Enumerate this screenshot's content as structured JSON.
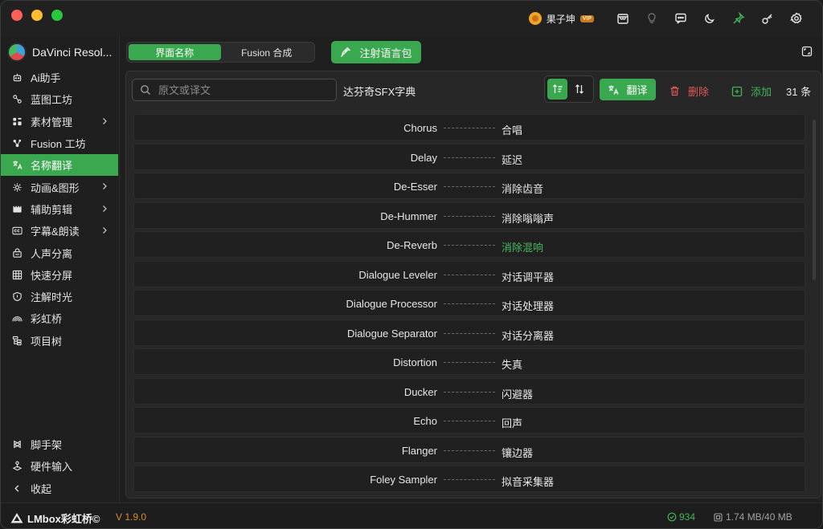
{
  "window": {
    "traffic_lights": [
      "close",
      "minimize",
      "zoom"
    ]
  },
  "titlebar": {
    "user_name": "果子坤",
    "vip_badge": "VIP",
    "icons": [
      "store-icon",
      "lightbulb-icon",
      "message-icon",
      "moon-icon",
      "pin-icon",
      "key-icon",
      "settings-icon"
    ]
  },
  "sidebar": {
    "app_title": "DaVinci Resol...",
    "items": [
      {
        "label": "Ai助手",
        "icon": "robot-icon",
        "has_submenu": false
      },
      {
        "label": "蓝图工坊",
        "icon": "blueprint-icon",
        "has_submenu": false
      },
      {
        "label": "素材管理",
        "icon": "assets-icon",
        "has_submenu": true
      },
      {
        "label": "Fusion 工坊",
        "icon": "fusion-icon",
        "has_submenu": false
      },
      {
        "label": "名称翻译",
        "icon": "translate-icon",
        "has_submenu": false,
        "active": true
      },
      {
        "label": "动画&图形",
        "icon": "animation-icon",
        "has_submenu": true
      },
      {
        "label": "辅助剪辑",
        "icon": "edit-icon",
        "has_submenu": true
      },
      {
        "label": "字幕&朗读",
        "icon": "cc-icon",
        "has_submenu": true
      },
      {
        "label": "人声分离",
        "icon": "voice-icon",
        "has_submenu": false
      },
      {
        "label": "快速分屏",
        "icon": "grid-icon",
        "has_submenu": false
      },
      {
        "label": "注解时光",
        "icon": "shield-icon",
        "has_submenu": false
      },
      {
        "label": "彩虹桥",
        "icon": "rainbow-icon",
        "has_submenu": false
      },
      {
        "label": "项目树",
        "icon": "tree-icon",
        "has_submenu": false
      }
    ],
    "bottom_items": [
      {
        "label": "脚手架",
        "icon": "scaffold-icon"
      },
      {
        "label": "硬件输入",
        "icon": "joystick-icon"
      },
      {
        "label": "收起",
        "icon": "collapse-icon"
      }
    ]
  },
  "toolbar": {
    "tabs": [
      {
        "label": "界面名称",
        "active": true
      },
      {
        "label": "Fusion 合成",
        "active": false
      }
    ],
    "inject_label": "注射语言包"
  },
  "panel": {
    "search_placeholder": "原文或译文",
    "dictionary_name": "达芬奇SFX字典",
    "translate_label": "翻译",
    "delete_label": "删除",
    "add_label": "添加",
    "count_label": "31 条"
  },
  "entries": [
    {
      "en": "Chorus",
      "zh": "合唱"
    },
    {
      "en": "Delay",
      "zh": "延迟"
    },
    {
      "en": "De-Esser",
      "zh": "消除齿音"
    },
    {
      "en": "De-Hummer",
      "zh": "消除嗡嗡声"
    },
    {
      "en": "De-Reverb",
      "zh": "消除混响",
      "highlighted": true
    },
    {
      "en": "Dialogue Leveler",
      "zh": "对话调平器"
    },
    {
      "en": "Dialogue Processor",
      "zh": "对话处理器"
    },
    {
      "en": "Dialogue Separator",
      "zh": "对话分离器"
    },
    {
      "en": "Distortion",
      "zh": "失真"
    },
    {
      "en": "Ducker",
      "zh": "闪避器"
    },
    {
      "en": "Echo",
      "zh": "回声"
    },
    {
      "en": "Flanger",
      "zh": "镶边器"
    },
    {
      "en": "Foley Sampler",
      "zh": "拟音采集器"
    }
  ],
  "statusbar": {
    "brand": "LMbox彩虹桥©",
    "version": "V 1.9.0",
    "stat_count": "934",
    "memory": "1.74 MB/40 MB"
  },
  "colors": {
    "accent": "#3aa84f",
    "danger": "#e05a5a",
    "version": "#d98a2a"
  }
}
